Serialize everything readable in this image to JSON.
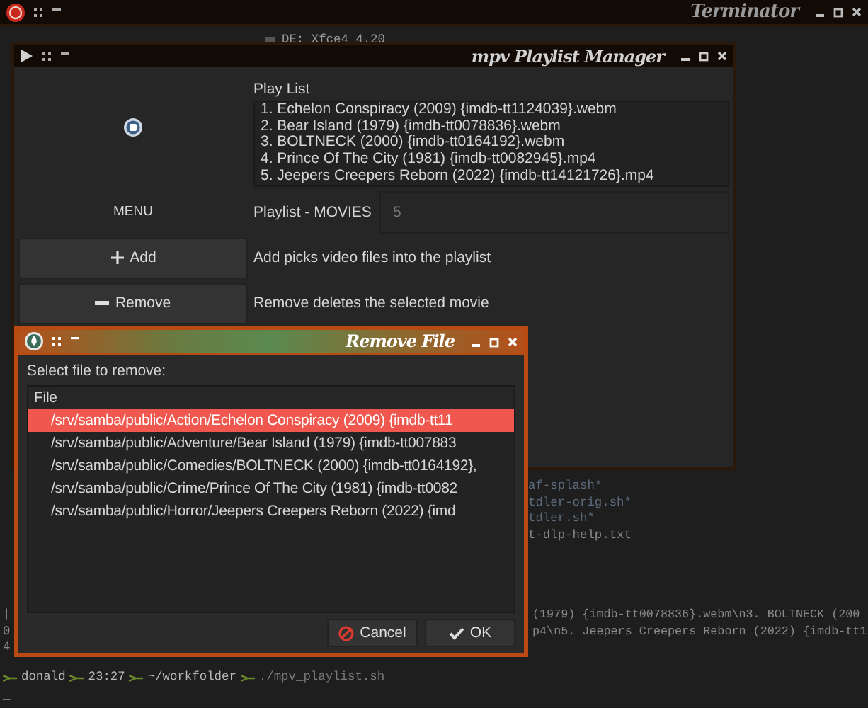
{
  "terminal": {
    "title": "Terminator",
    "sysinfo": "DE: Xfce4 4.20",
    "listing": [
      {
        "name": "af-splash*",
        "kind": "executable"
      },
      {
        "name": "tdler-orig.sh*",
        "kind": "executable"
      },
      {
        "name": "tdler.sh*",
        "kind": "executable"
      },
      {
        "name": "t-dlp-help.txt",
        "kind": "file"
      }
    ],
    "output": [
      {
        "edge": "|",
        "text": "(1979) {imdb-tt0078836}.webm\\n3. BOLTNECK (200"
      },
      {
        "edge": "0",
        "text": "p4\\n5. Jeepers Creepers Reborn (2022) {imdb-tt1"
      },
      {
        "edge": "4"
      }
    ],
    "prompt": {
      "user": "donald",
      "time": "23:27",
      "dir": "~/workfolder",
      "command": "./mpv_playlist.sh"
    },
    "cursor": "_"
  },
  "playlist_manager": {
    "title": "mpv Playlist Manager",
    "playlist_label": "Play List",
    "playlist": [
      "1. Echelon Conspiracy (2009) {imdb-tt1124039}.webm",
      "2. Bear Island (1979) {imdb-tt0078836}.webm",
      "3. BOLTNECK (2000) {imdb-tt0164192}.webm",
      "4. Prince Of The City (1981) {imdb-tt0082945}.mp4",
      "5. Jeepers Creepers Reborn (2022) {imdb-tt14121726}.mp4"
    ],
    "menu_label": "MENU",
    "count_label": "Playlist - MOVIES",
    "count": "5",
    "actions": [
      {
        "kind": "add",
        "label": "Add",
        "description": "Add picks video files into the playlist"
      },
      {
        "kind": "remove",
        "label": "Remove",
        "description": "Remove deletes the selected movie"
      }
    ]
  },
  "remove_dialog": {
    "title": "Remove File",
    "prompt": "Select file to remove:",
    "column": "File",
    "files": [
      {
        "path": "/srv/samba/public/Action/Echelon Conspiracy (2009) {imdb-tt11",
        "selected": true
      },
      {
        "path": "/srv/samba/public/Adventure/Bear Island (1979) {imdb-tt007883",
        "selected": false
      },
      {
        "path": "/srv/samba/public/Comedies/BOLTNECK (2000) {imdb-tt0164192},",
        "selected": false
      },
      {
        "path": "/srv/samba/public/Crime/Prince Of The City (1981) {imdb-tt0082",
        "selected": false
      },
      {
        "path": "/srv/samba/public/Horror/Jeepers Creepers Reborn (2022) {imd",
        "selected": false
      }
    ],
    "buttons": [
      {
        "kind": "cancel",
        "label": "Cancel"
      },
      {
        "kind": "ok",
        "label": "OK"
      }
    ]
  }
}
